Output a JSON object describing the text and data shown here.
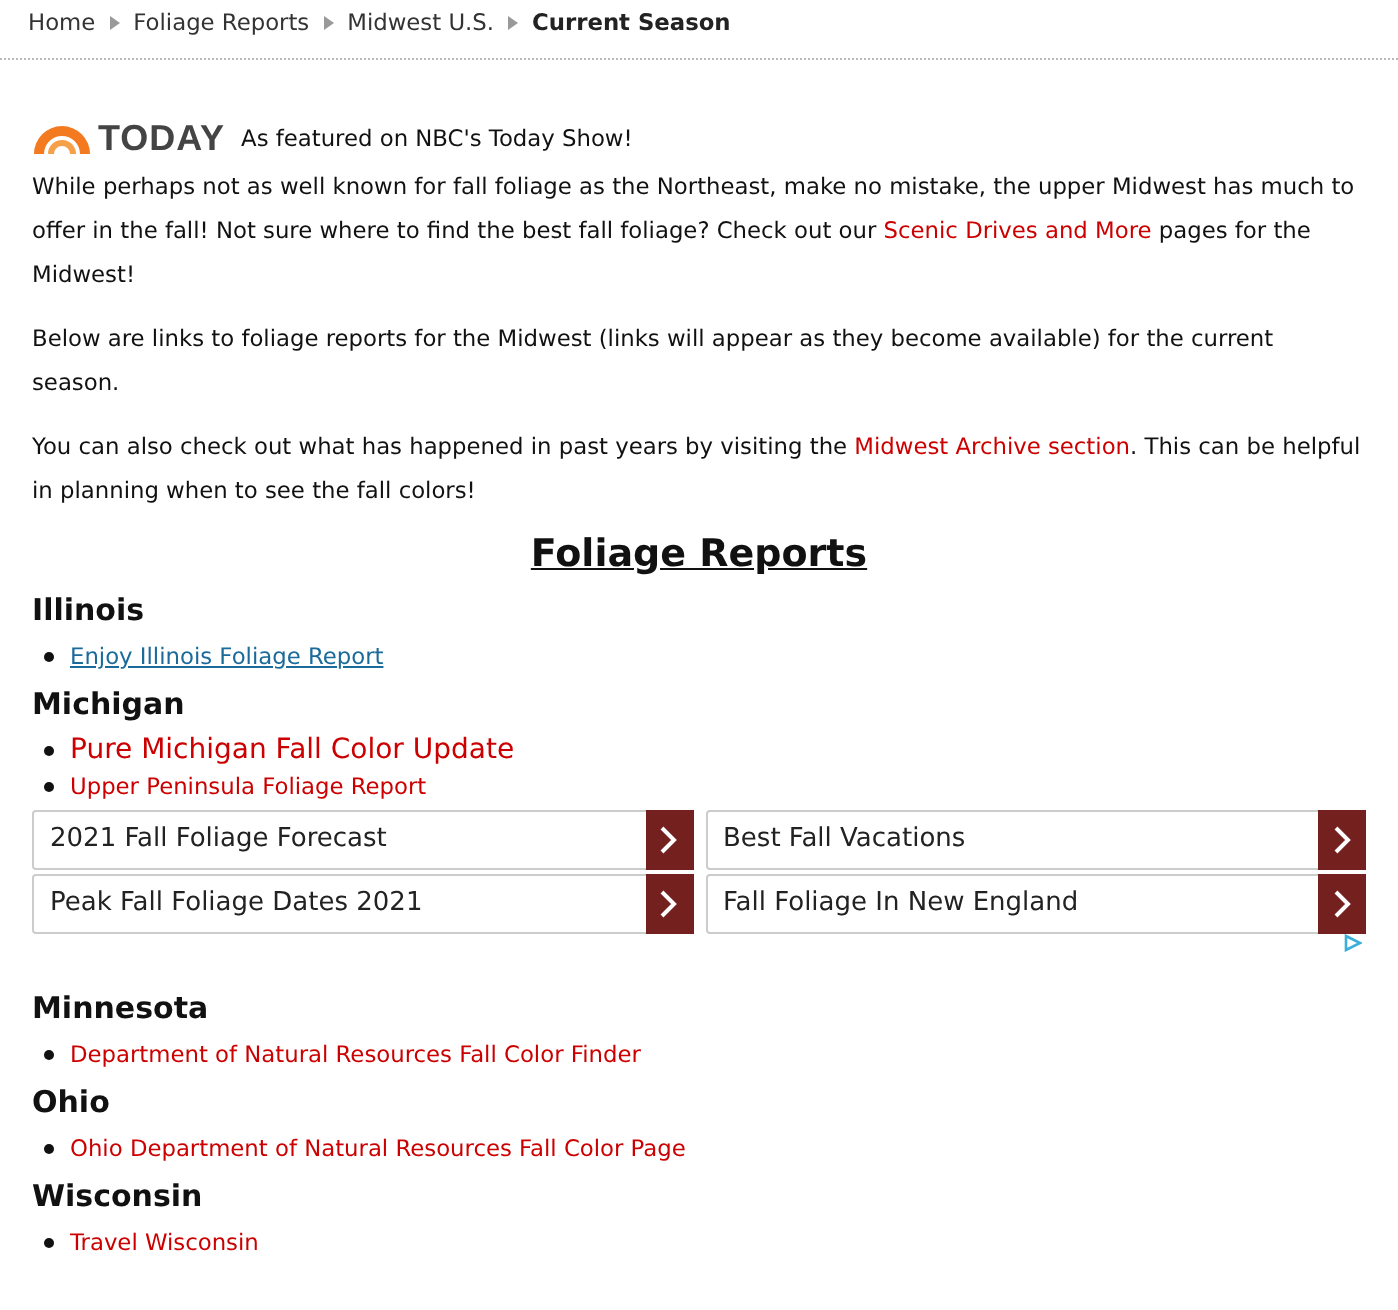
{
  "breadcrumb": [
    {
      "label": "Home",
      "current": false
    },
    {
      "label": "Foliage Reports",
      "current": false
    },
    {
      "label": "Midwest U.S.",
      "current": false
    },
    {
      "label": "Current Season",
      "current": true
    }
  ],
  "featured": {
    "logo": "TODAY",
    "text": "As featured on NBC's Today Show!"
  },
  "paragraphs": [
    [
      {
        "text": "While perhaps not as well known for fall foliage as the Northeast, make no mistake, the upper Midwest has much to offer in the fall! Not sure where to find the best fall foliage? Check out our ",
        "link": false
      },
      {
        "text": "Scenic Drives and More",
        "link": true
      },
      {
        "text": " pages for the Midwest!",
        "link": false
      }
    ],
    [
      {
        "text": "Below are links to foliage reports for the Midwest (links will appear as they become available) for the current season.",
        "link": false
      }
    ],
    [
      {
        "text": "You can also check out what has happened in past years by visiting the ",
        "link": false
      },
      {
        "text": "Midwest Archive section",
        "link": true
      },
      {
        "text": ".  This can be helpful in planning when to see the fall colors!",
        "link": false
      }
    ]
  ],
  "title": "Foliage Reports",
  "sections": [
    {
      "state": "Illinois",
      "links": [
        {
          "text": "Enjoy Illinois Foliage Report",
          "kind": "underlined"
        }
      ]
    },
    {
      "state": "Michigan",
      "links": [
        {
          "text": "Pure Michigan Fall Color Update",
          "kind": "large"
        },
        {
          "text": "Upper Peninsula Foliage Report",
          "kind": "plain"
        }
      ],
      "ads": [
        "2021 Fall Foliage Forecast",
        "Best Fall Vacations",
        "Peak Fall Foliage Dates 2021",
        "Fall Foliage In New England"
      ]
    },
    {
      "state": "Minnesota",
      "links": [
        {
          "text": "Department of Natural Resources Fall Color Finder",
          "kind": "plain"
        }
      ]
    },
    {
      "state": "Ohio",
      "links": [
        {
          "text": "Ohio Department of Natural Resources Fall Color Page",
          "kind": "plain"
        }
      ]
    },
    {
      "state": "Wisconsin",
      "links": [
        {
          "text": "Travel Wisconsin",
          "kind": "plain"
        }
      ]
    }
  ]
}
